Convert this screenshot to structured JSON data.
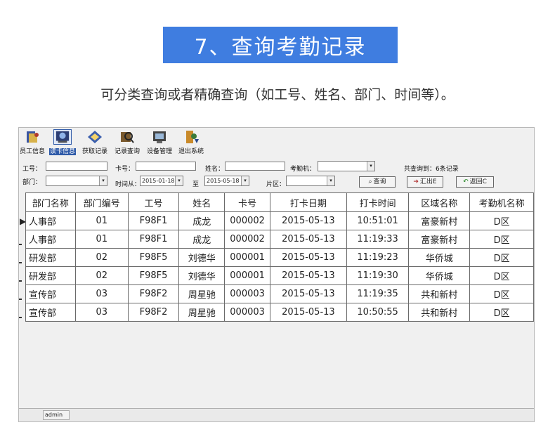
{
  "banner": {
    "title": "7、查询考勤记录"
  },
  "subtitle": "可分类查询或者精确查询（如工号、姓名、部门、时间等）。",
  "toolbar": {
    "items": [
      {
        "label": "员工信息",
        "icon": "employee-icon"
      },
      {
        "label": "读卡信息",
        "icon": "card-reader-icon"
      },
      {
        "label": "获取记录",
        "icon": "fetch-record-icon"
      },
      {
        "label": "记录查询",
        "icon": "record-query-icon"
      },
      {
        "label": "设备管理",
        "icon": "device-icon"
      },
      {
        "label": "退出系统",
        "icon": "exit-icon"
      }
    ]
  },
  "filters": {
    "job_no_label": "工号：",
    "card_no_label": "卡号：",
    "name_label": "姓名：",
    "machine_label": "考勤机：",
    "result_count": "共查询到：6条记录",
    "dept_label": "部门：",
    "time_from_label": "时间从：",
    "date_from": "2015-01-18",
    "to_label": "至",
    "date_to": "2015-05-18",
    "area_label": "片区：",
    "query_button": "查询",
    "export_button": "汇出E",
    "back_button": "返回C"
  },
  "table": {
    "headers": [
      "部门名称",
      "部门编号",
      "工号",
      "姓名",
      "卡号",
      "打卡日期",
      "打卡时间",
      "区域名称",
      "考勤机名称"
    ],
    "rows": [
      [
        "人事部",
        "01",
        "F98F1",
        "成龙",
        "000002",
        "2015-05-13",
        "10:51:01",
        "富豪新村",
        "D区"
      ],
      [
        "人事部",
        "01",
        "F98F1",
        "成龙",
        "000002",
        "2015-05-13",
        "11:19:33",
        "富豪新村",
        "D区"
      ],
      [
        "研发部",
        "02",
        "F98F5",
        "刘德华",
        "000001",
        "2015-05-13",
        "11:19:23",
        "华侨城",
        "D区"
      ],
      [
        "研发部",
        "02",
        "F98F5",
        "刘德华",
        "000001",
        "2015-05-13",
        "11:19:30",
        "华侨城",
        "D区"
      ],
      [
        "宣传部",
        "03",
        "F98F2",
        "周星驰",
        "000003",
        "2015-05-13",
        "11:19:35",
        "共和新村",
        "D区"
      ],
      [
        "宣传部",
        "03",
        "F98F2",
        "周星驰",
        "000003",
        "2015-05-13",
        "10:50:55",
        "共和新村",
        "D区"
      ]
    ]
  },
  "status": {
    "user": "admin"
  },
  "colors": {
    "banner": "#3f7de0",
    "active_tab": "#2e5aa8"
  }
}
